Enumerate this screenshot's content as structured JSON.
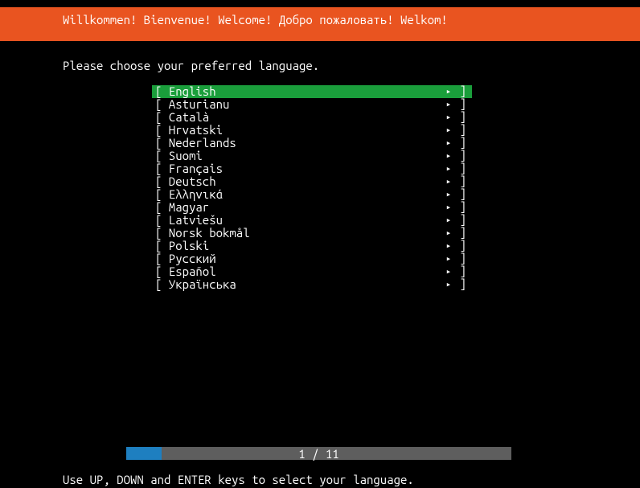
{
  "header": {
    "title": "Willkommen! Bienvenue! Welcome! Добро пожаловать! Welkom!"
  },
  "instruction": "Please choose your preferred language.",
  "languages": [
    {
      "name": "English",
      "selected": true
    },
    {
      "name": "Asturianu",
      "selected": false
    },
    {
      "name": "Català",
      "selected": false
    },
    {
      "name": "Hrvatski",
      "selected": false
    },
    {
      "name": "Nederlands",
      "selected": false
    },
    {
      "name": "Suomi",
      "selected": false
    },
    {
      "name": "Français",
      "selected": false
    },
    {
      "name": "Deutsch",
      "selected": false
    },
    {
      "name": "Ελληνικά",
      "selected": false
    },
    {
      "name": "Magyar",
      "selected": false
    },
    {
      "name": "Latviešu",
      "selected": false
    },
    {
      "name": "Norsk bokmål",
      "selected": false
    },
    {
      "name": "Polski",
      "selected": false
    },
    {
      "name": "Русский",
      "selected": false
    },
    {
      "name": "Español",
      "selected": false
    },
    {
      "name": "Українська",
      "selected": false
    }
  ],
  "progress": {
    "current": 1,
    "total": 11,
    "text": "1 / 11"
  },
  "hint": "Use UP, DOWN and ENTER keys to select your language.",
  "glyphs": {
    "arrow": "▸",
    "left_bracket": "[",
    "right_bracket": "]"
  }
}
